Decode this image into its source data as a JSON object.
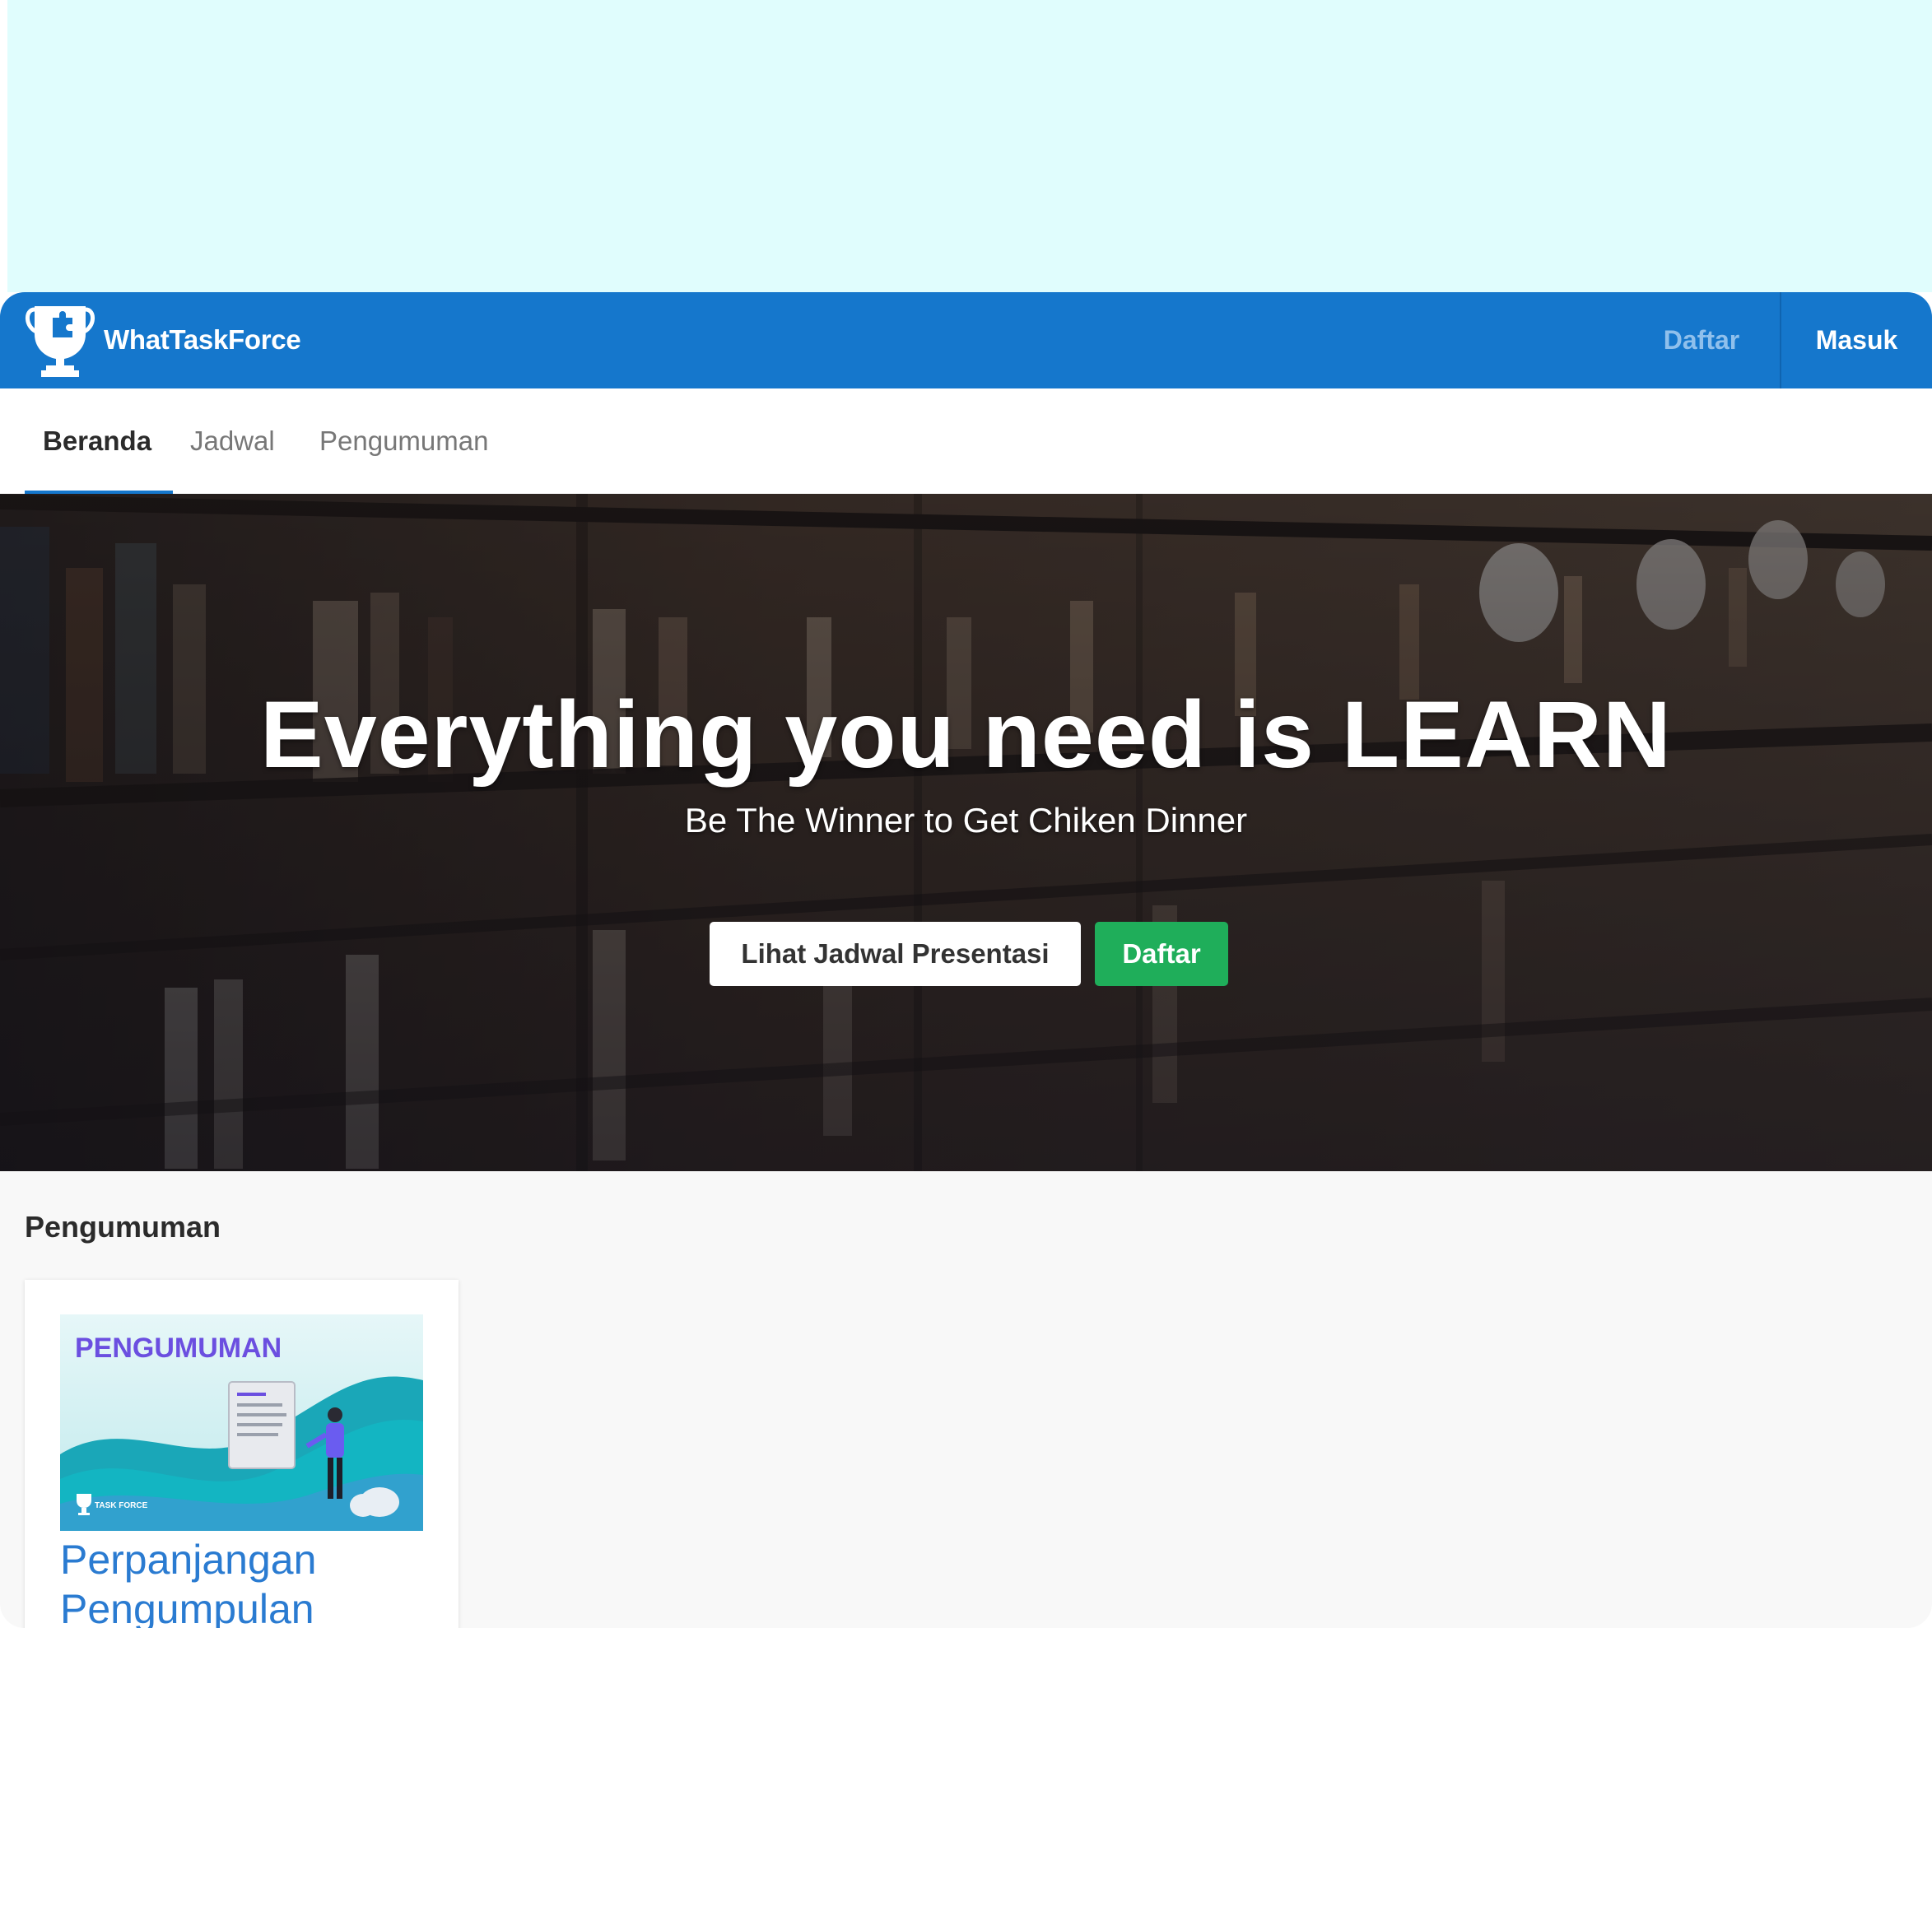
{
  "app": {
    "brand_name": "WhatTaskForce",
    "brand_icon": "trophy-puzzle-icon",
    "accent_color": "#1577cc"
  },
  "topnav": {
    "register_label": "Daftar",
    "login_label": "Masuk"
  },
  "tabs": [
    {
      "label": "Beranda",
      "active": true
    },
    {
      "label": "Jadwal",
      "active": false
    },
    {
      "label": "Pengumuman",
      "active": false
    }
  ],
  "hero": {
    "title": "Everything you need is LEARN",
    "subtitle": "Be The Winner to Get Chiken Dinner",
    "schedule_button": "Lihat Jadwal Presentasi",
    "register_button": "Daftar",
    "register_button_color": "#1fae5a"
  },
  "announcements": {
    "section_title": "Pengumuman",
    "items": [
      {
        "image_heading": "PENGUMUMAN",
        "image_logo_text": "TASK FORCE",
        "title": "Perpanjangan Pengumpulan"
      }
    ]
  }
}
